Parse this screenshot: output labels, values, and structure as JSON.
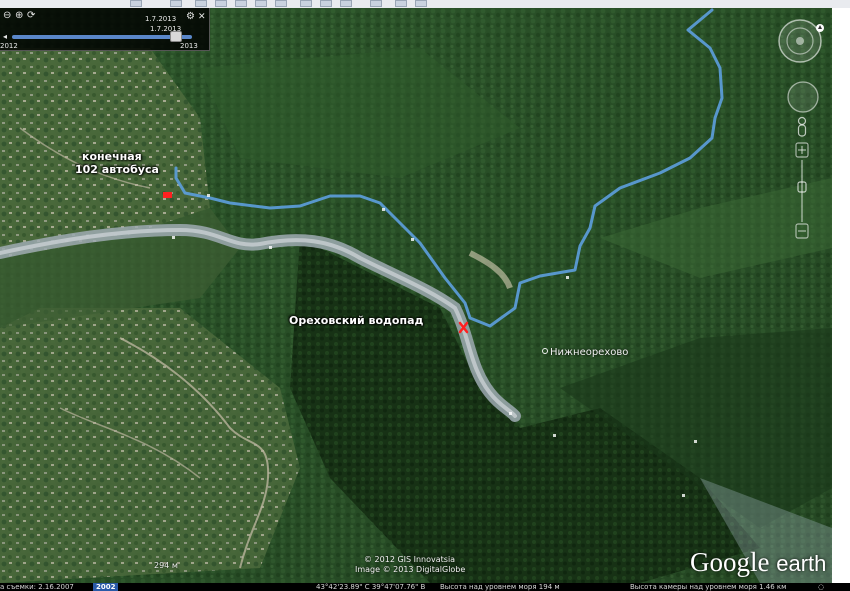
{
  "time_slider": {
    "date_top": "1.7.2013",
    "date_current": "1.7.2013",
    "range_start": "2012",
    "range_end": "2013"
  },
  "map": {
    "label_bus_line1": "конечная",
    "label_bus_line2": "102 автобуса",
    "label_waterfall": "Ореховский водопад",
    "place_name": "Нижнеорехово",
    "scale": "294 м",
    "attribution_line1": "© 2012 GIS Innovatsia",
    "attribution_line2": "Image © 2013 DigitalGlobe",
    "logo_google": "Google",
    "logo_earth": "earth",
    "route_color": "#5b9bd5",
    "marker_color": "#ff2020"
  },
  "status_bar": {
    "capture_date": "а съемки: 2.16.2007",
    "year_badge": "2002",
    "coordinates": "43°42'23.89\" С  39°47'07.76\" В",
    "elevation": "Высота над уровнем моря   194 м",
    "eye_altitude": "Высота камеры над уровнем моря   1.46 км"
  }
}
